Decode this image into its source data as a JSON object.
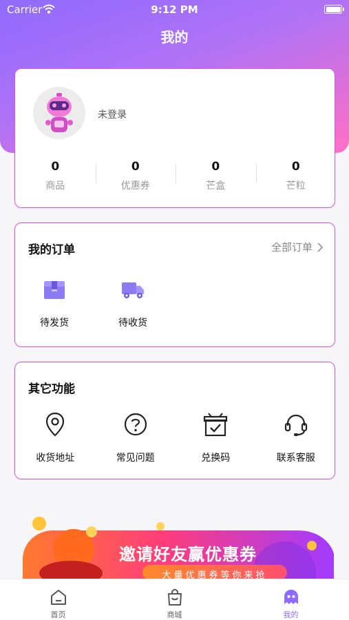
{
  "status_bar": {
    "carrier": "Carrier",
    "time": "9:12 PM"
  },
  "page_title": "我的",
  "profile": {
    "login_status": "未登录",
    "stats": [
      {
        "value": "0",
        "label": "商品"
      },
      {
        "value": "0",
        "label": "优惠券"
      },
      {
        "value": "0",
        "label": "芒盒"
      },
      {
        "value": "0",
        "label": "芒粒"
      }
    ]
  },
  "orders": {
    "title": "我的订单",
    "all_orders_label": "全部订单",
    "items": [
      {
        "label": "待发货",
        "icon": "package-icon"
      },
      {
        "label": "待收货",
        "icon": "truck-icon"
      }
    ]
  },
  "other_functions": {
    "title": "其它功能",
    "items": [
      {
        "label": "收货地址",
        "icon": "location-pin-icon"
      },
      {
        "label": "常见问题",
        "icon": "question-icon"
      },
      {
        "label": "兑换码",
        "icon": "gift-box-icon"
      },
      {
        "label": "联系客服",
        "icon": "headset-icon"
      }
    ]
  },
  "banner": {
    "title": "邀请好友赢优惠券",
    "subtitle": "大量优惠券等你来抢"
  },
  "tabbar": {
    "items": [
      {
        "label": "首页",
        "icon": "home-icon"
      },
      {
        "label": "商城",
        "icon": "shopping-bag-icon"
      },
      {
        "label": "我的",
        "icon": "ghost-profile-icon"
      }
    ],
    "active_index": 2
  },
  "colors": {
    "accent": "#8f6bff",
    "card_border": "#d94ff0",
    "header_gradient_end": "#ff6fc6"
  }
}
